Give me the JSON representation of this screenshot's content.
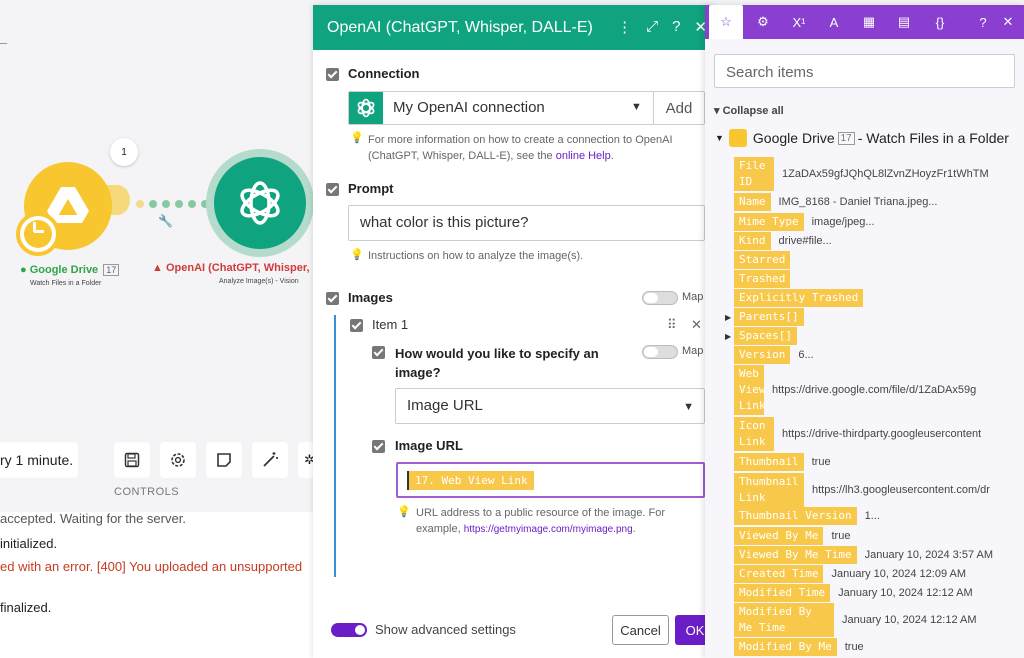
{
  "canvas": {
    "dash": "–",
    "bubble_count": "1",
    "google_drive_label": "Google Drive",
    "google_drive_badge": "17",
    "google_drive_sub": "Watch Files in a Folder",
    "openai_label": "OpenAI (ChatGPT, Whisper, D",
    "openai_sub": "Analyze Image(s) - Vision",
    "schedule_text": "ry 1 minute.",
    "controls_label": "CONTROLS",
    "log_lines": [
      "accepted. Waiting for the server.",
      "initialized.",
      "ed with an error. [400] You uploaded an unsupported",
      "finalized."
    ]
  },
  "openai_panel": {
    "title": "OpenAI (ChatGPT, Whisper, DALL-E)",
    "connection_heading": "Connection",
    "connection_value": "My OpenAI connection",
    "add_button": "Add",
    "connection_hint": "For more information on how to create a connection to OpenAI (ChatGPT, Whisper, DALL-E), see the",
    "connection_hint_link": "online Help",
    "prompt_heading": "Prompt",
    "prompt_value": "what color is this picture?",
    "prompt_hint": "Instructions on how to analyze the image(s).",
    "images_heading": "Images",
    "map_label": "Map",
    "item_label": "Item 1",
    "specify_question": "How would you like to specify an image?",
    "specify_value": "Image URL",
    "image_url_heading": "Image URL",
    "image_url_pill": "17. Web View Link",
    "image_url_hint": "URL address to a public resource of the image. For example,",
    "image_url_hint_link": "https://getmyimage.com/myimage.png",
    "advanced_label": "Show advanced settings",
    "cancel_button": "Cancel",
    "ok_button": "OK"
  },
  "mapping_panel": {
    "search_placeholder": "Search items",
    "collapse_all": "Collapse all",
    "module_name": "Google Drive",
    "module_badge": "17",
    "module_suffix": "- Watch Files in a Folder",
    "fields": [
      {
        "key": "File ID",
        "value": "1ZaDAx59gfJQhQL8lZvnZHoyzFr1tWhTM"
      },
      {
        "key": "Name",
        "value": "IMG_8168 - Daniel Triana.jpeg..."
      },
      {
        "key": "Mime Type",
        "value": "image/jpeg..."
      },
      {
        "key": "Kind",
        "value": "drive#file..."
      },
      {
        "key": "Starred",
        "value": ""
      },
      {
        "key": "Trashed",
        "value": ""
      },
      {
        "key": "Explicitly Trashed",
        "value": ""
      },
      {
        "key": "Parents[]",
        "value": ""
      },
      {
        "key": "Spaces[]",
        "value": ""
      },
      {
        "key": "Version",
        "value": "6..."
      },
      {
        "key": "Web View Link",
        "value": "https://drive.google.com/file/d/1ZaDAx59g"
      },
      {
        "key": "Icon Link",
        "value": "https://drive-thirdparty.googleusercontent"
      },
      {
        "key": "Thumbnail",
        "value": "true"
      },
      {
        "key": "Thumbnail Link",
        "value": "https://lh3.googleusercontent.com/dr"
      },
      {
        "key": "Thumbnail Version",
        "value": "1..."
      },
      {
        "key": "Viewed By Me",
        "value": "true"
      },
      {
        "key": "Viewed By Me Time",
        "value": "January 10, 2024 3:57 AM"
      },
      {
        "key": "Created Time",
        "value": "January 10, 2024 12:09 AM"
      },
      {
        "key": "Modified Time",
        "value": "January 10, 2024 12:12 AM"
      },
      {
        "key": "Modified By Me Time",
        "value": "January 10, 2024 12:12 AM"
      },
      {
        "key": "Modified By Me",
        "value": "true"
      }
    ]
  },
  "colors": {
    "openai_green": "#10a37f",
    "make_purple": "#6b1ec8",
    "mapping_tab_purple": "#8a3fd1",
    "pill_yellow": "#f8c84a",
    "drive_yellow": "#f8c62e",
    "error_red": "#c73b21"
  }
}
